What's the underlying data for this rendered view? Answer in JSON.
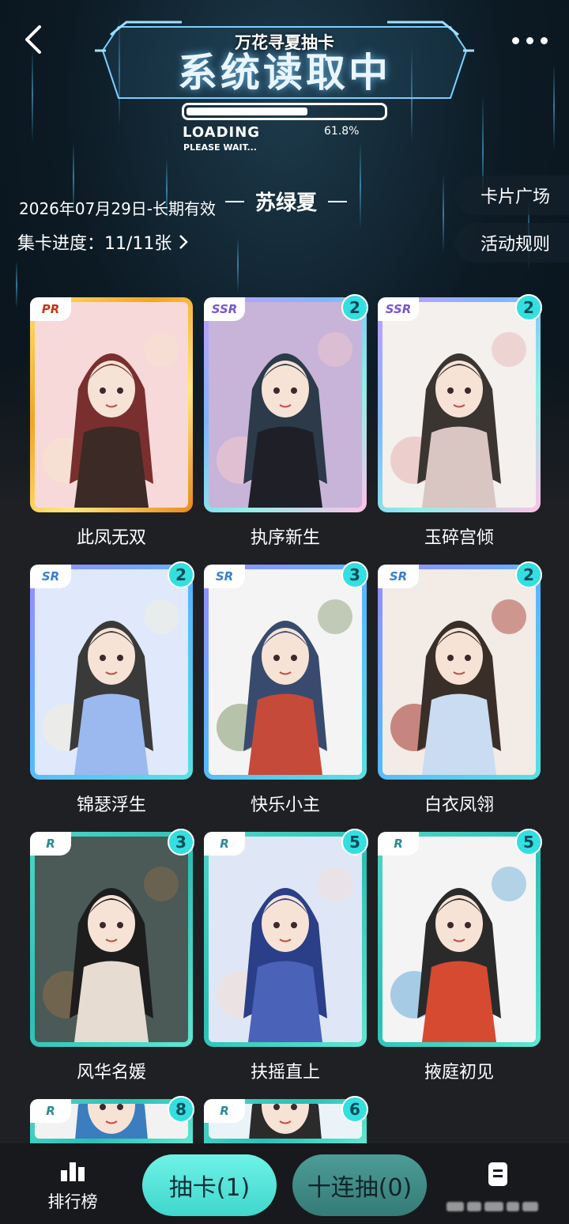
{
  "header": {
    "small_title": "万花寻夏抽卡",
    "big_title": "系统读取中",
    "loading_text": "LOADING",
    "please_wait": "PLEASE WAIT...",
    "progress_percent": "61.8%",
    "progress_value": 0.618,
    "date_text": "2026年07月29日-长期有效",
    "collection_name": "苏绿夏",
    "collect_progress": "集卡进度：11/11张",
    "card_square_button": "卡片广场",
    "rules_button": "活动规则"
  },
  "cards": [
    {
      "name": "此凤无双",
      "rarity": "PR",
      "count": ""
    },
    {
      "name": "执序新生",
      "rarity": "SSR",
      "count": "2"
    },
    {
      "name": "玉碎宫倾",
      "rarity": "SSR",
      "count": "2"
    },
    {
      "name": "锦瑟浮生",
      "rarity": "SR",
      "count": "2"
    },
    {
      "name": "快乐小主",
      "rarity": "SR",
      "count": "3"
    },
    {
      "name": "白衣凤翎",
      "rarity": "SR",
      "count": "2"
    },
    {
      "name": "风华名媛",
      "rarity": "R",
      "count": "3"
    },
    {
      "name": "扶摇直上",
      "rarity": "R",
      "count": "5"
    },
    {
      "name": "掖庭初见",
      "rarity": "R",
      "count": "5"
    },
    {
      "name": "",
      "rarity": "R",
      "count": "8"
    },
    {
      "name": "",
      "rarity": "R",
      "count": "6"
    }
  ],
  "bottom": {
    "rank_label": "排行榜",
    "draw_button": "抽卡(1)",
    "draw10_button": "十连抽(0)"
  },
  "colors": {
    "accent_teal": "#3fd7cd",
    "badge": "#34dfe0",
    "background": "#1e2024"
  },
  "icons": [
    "back-arrow-icon",
    "more-icon",
    "chevron-right-icon",
    "ranking-icon",
    "task-list-icon"
  ]
}
